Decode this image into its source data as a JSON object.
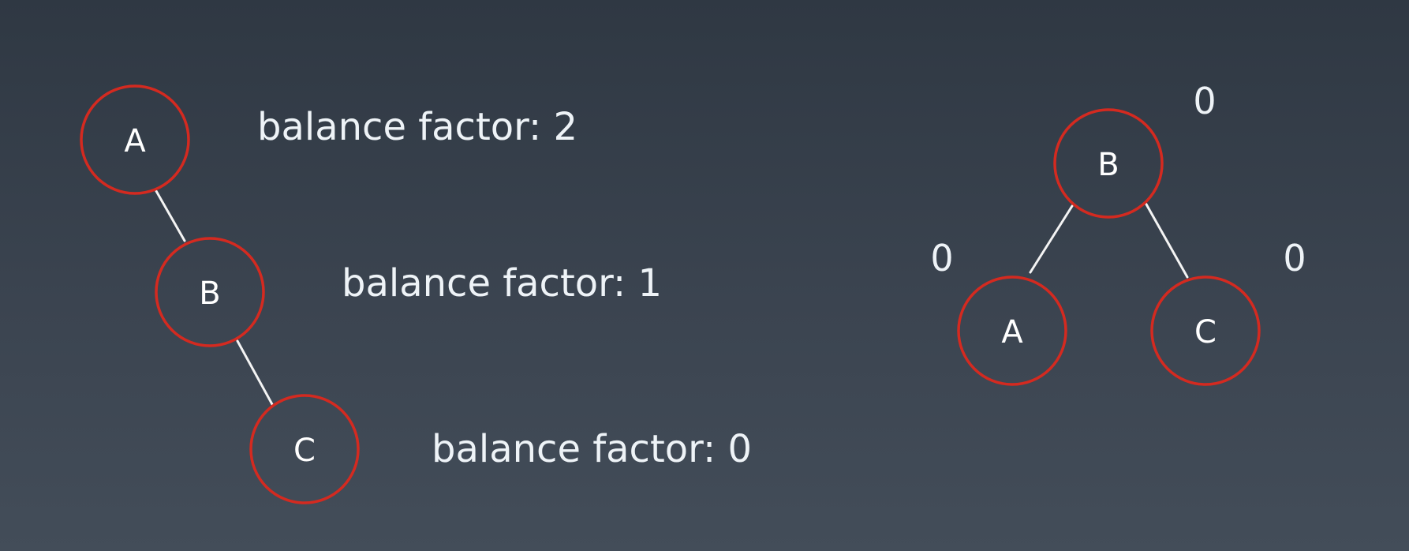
{
  "left_tree": {
    "nodes": [
      {
        "label": "A",
        "balance_text": "balance factor: 2"
      },
      {
        "label": "B",
        "balance_text": "balance factor: 1"
      },
      {
        "label": "C",
        "balance_text": "balance factor: 0"
      }
    ]
  },
  "right_tree": {
    "root": {
      "label": "B",
      "balance": "0"
    },
    "left": {
      "label": "A",
      "balance": "0"
    },
    "right": {
      "label": "C",
      "balance": "0"
    }
  },
  "colors": {
    "node_stroke": "#d42a20",
    "edge": "#f4f4f4",
    "text": "#eef3f7"
  }
}
